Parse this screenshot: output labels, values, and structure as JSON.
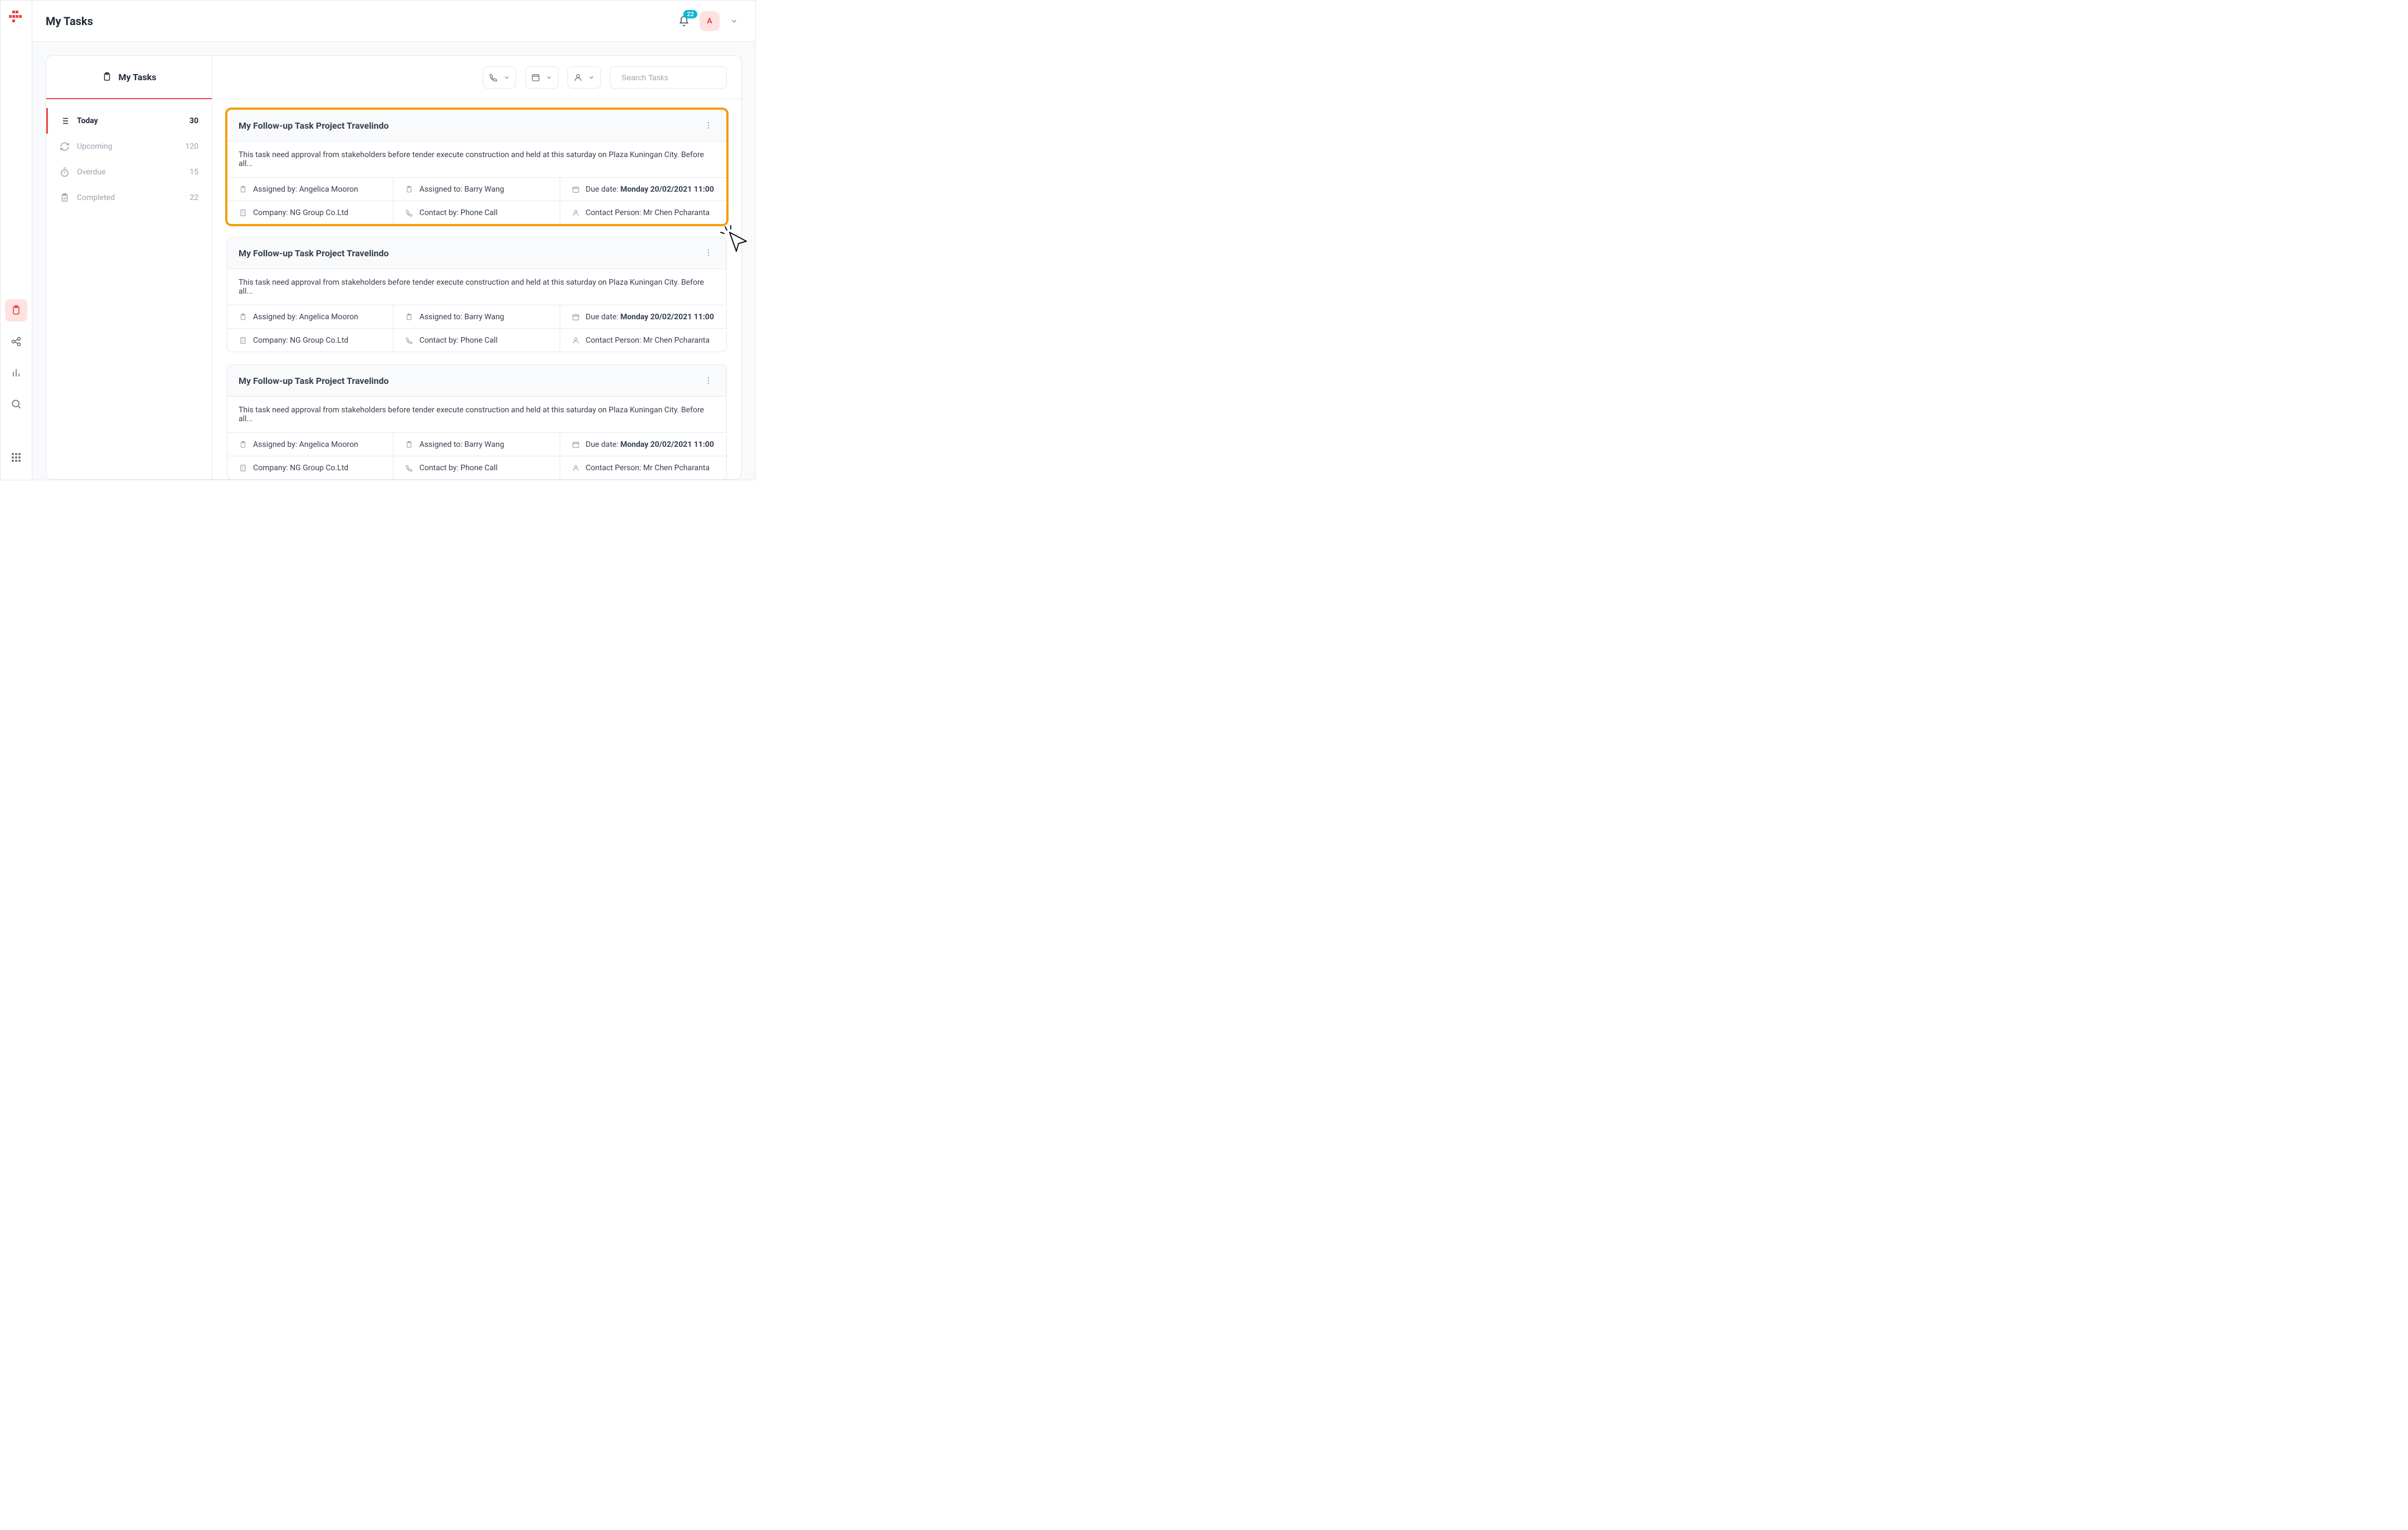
{
  "header": {
    "title": "My Tasks",
    "notification_count": "22",
    "avatar_letter": "A"
  },
  "panel": {
    "tab_label": "My Tasks",
    "items": [
      {
        "label": "Today",
        "count": "30"
      },
      {
        "label": "Upcoming",
        "count": "120"
      },
      {
        "label": "Overdue",
        "count": "15"
      },
      {
        "label": "Completed",
        "count": "22"
      }
    ]
  },
  "toolbar": {
    "search_placeholder": "Search Tasks"
  },
  "task": {
    "title": "My Follow-up Task Project Travelindo",
    "desc": "This task need approval from stakeholders before tender execute construction and held at this saturday on Plaza Kuningan City. Before all...",
    "assigned_by_label": "Assigned by: ",
    "assigned_by_value": "Angelica Mooron",
    "assigned_to_label": "Assigned to: ",
    "assigned_to_value": "Barry Wang",
    "due_label": "Due date: ",
    "due_value": "Monday 20/02/2021 11:00",
    "company_label": "Company: ",
    "company_value": "NG Group Co.Ltd",
    "contact_by_label": "Contact by: ",
    "contact_by_value": "Phone Call",
    "contact_person_label": "Contact Person: ",
    "contact_person_value": "Mr Chen Pcharanta"
  }
}
